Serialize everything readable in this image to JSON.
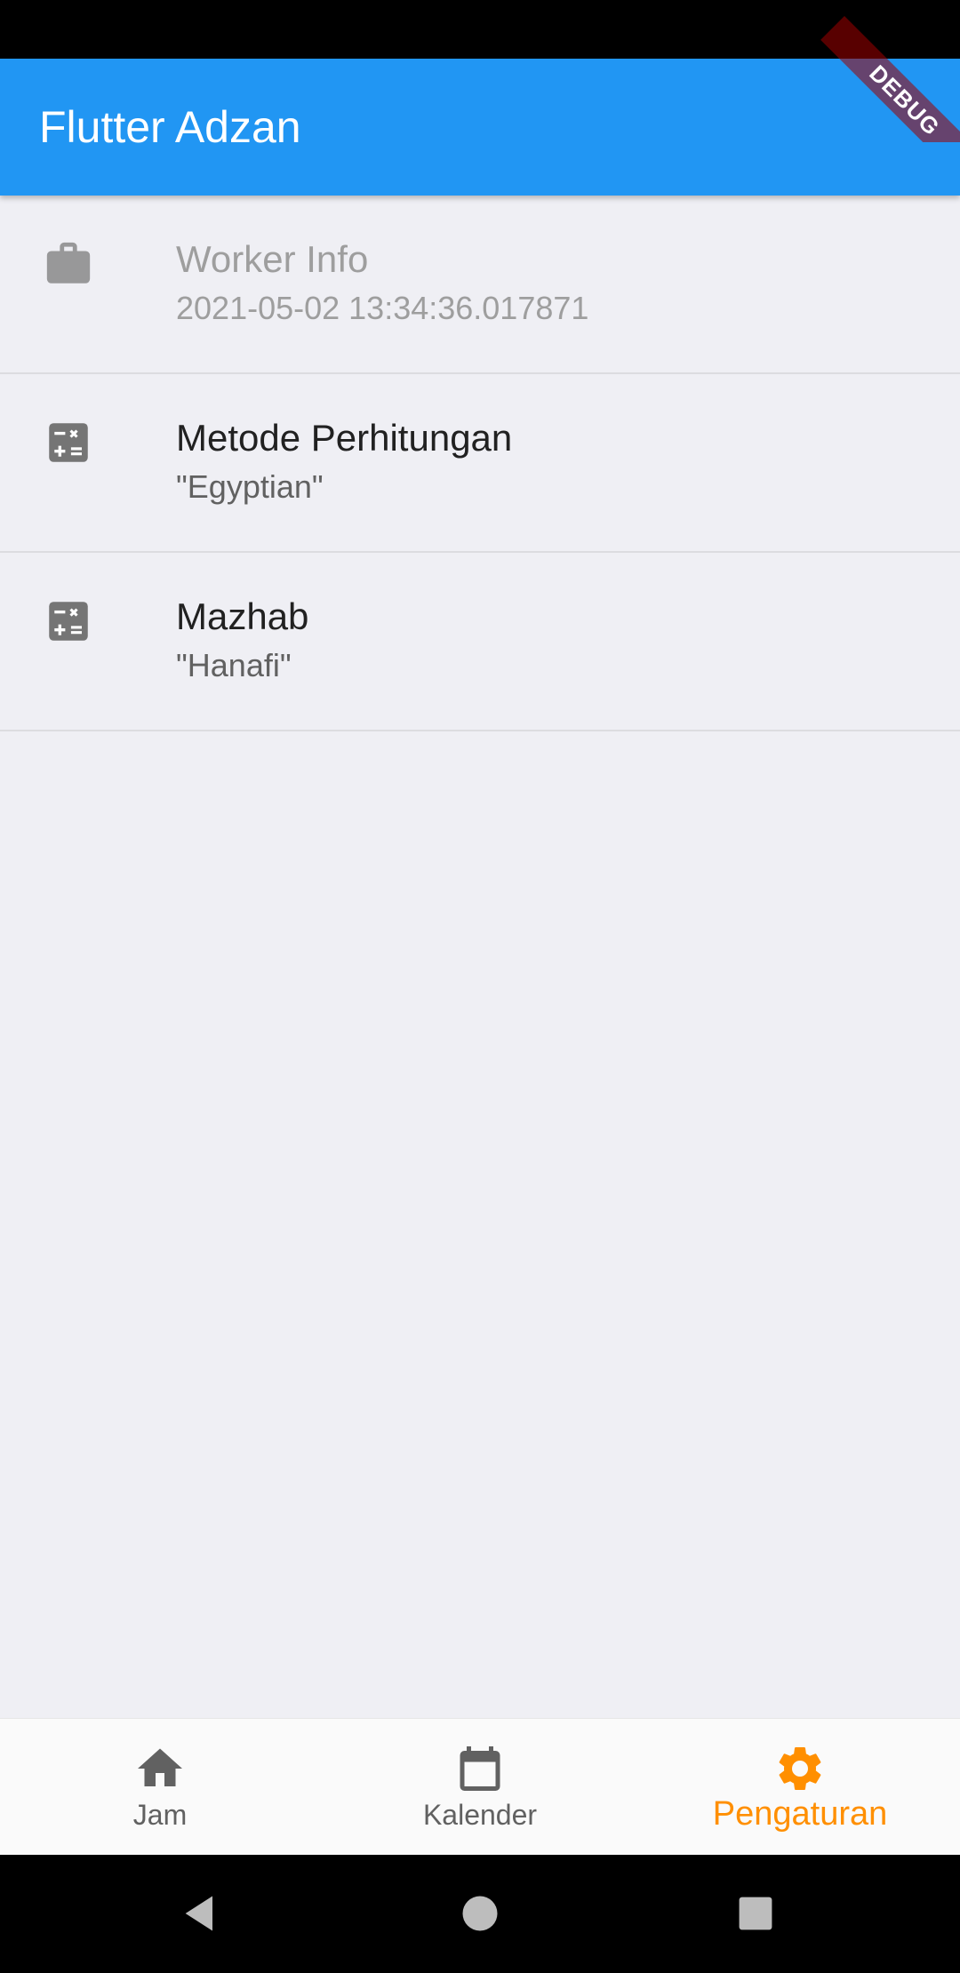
{
  "app_bar": {
    "title": "Flutter Adzan",
    "color": "#2196F3"
  },
  "debug_banner": "DEBUG",
  "settings": {
    "items": [
      {
        "title": "Worker Info",
        "subtitle": "2021-05-02 13:34:36.017871",
        "icon": "work-icon",
        "enabled": false
      },
      {
        "title": "Metode Perhitungan",
        "subtitle": "\"Egyptian\"",
        "icon": "calculate-icon",
        "enabled": true
      },
      {
        "title": "Mazhab",
        "subtitle": "\"Hanafi\"",
        "icon": "calculate-icon",
        "enabled": true
      }
    ]
  },
  "bottom_nav": {
    "active_color": "#FF8F00",
    "items": [
      {
        "label": "Jam",
        "icon": "home-icon",
        "active": false
      },
      {
        "label": "Kalender",
        "icon": "calendar-icon",
        "active": false
      },
      {
        "label": "Pengaturan",
        "icon": "gear-icon",
        "active": true
      }
    ]
  },
  "system_nav": {
    "buttons": [
      "back-icon",
      "home-circle-icon",
      "recents-icon"
    ]
  }
}
